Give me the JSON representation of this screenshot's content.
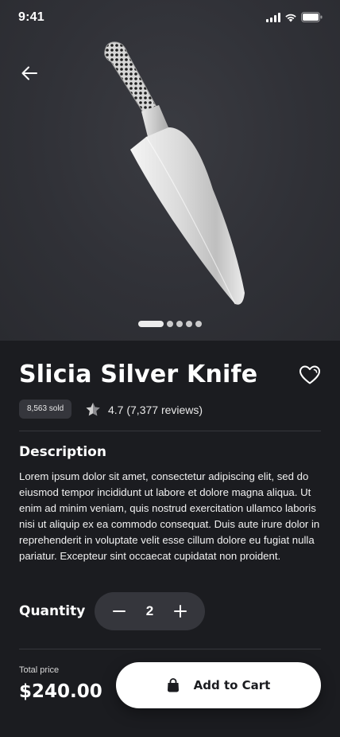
{
  "status_bar": {
    "time": "9:41"
  },
  "product": {
    "title": "Slicia Silver Knife",
    "sold_badge": "8,563 sold",
    "rating_text": "4.7 (7,377 reviews)"
  },
  "gallery": {
    "page_count": 5,
    "active_index": 0
  },
  "description": {
    "heading": "Description",
    "text": "Lorem ipsum dolor sit amet, consectetur adipiscing elit, sed do eiusmod tempor incididunt ut labore et dolore magna aliqua. Ut enim ad minim veniam, quis nostrud exercitation ullamco laboris nisi ut aliquip ex ea commodo consequat. Duis aute irure dolor in reprehenderit in voluptate velit esse cillum dolore eu fugiat nulla pariatur. Excepteur sint occaecat cupidatat non proident."
  },
  "quantity": {
    "label": "Quantity",
    "value": "2"
  },
  "footer": {
    "total_label": "Total price",
    "total_value": "$240.00",
    "add_to_cart_label": "Add to Cart"
  },
  "icons": {
    "back": "arrow-left-icon",
    "favorite": "heart-icon",
    "rating": "star-icon",
    "minus": "minus-icon",
    "plus": "plus-icon",
    "cart": "shopping-bag-icon"
  },
  "colors": {
    "background": "#1b1c20",
    "hero_background": "#303137",
    "chip_background": "#35363c",
    "button_background": "#ffffff"
  }
}
